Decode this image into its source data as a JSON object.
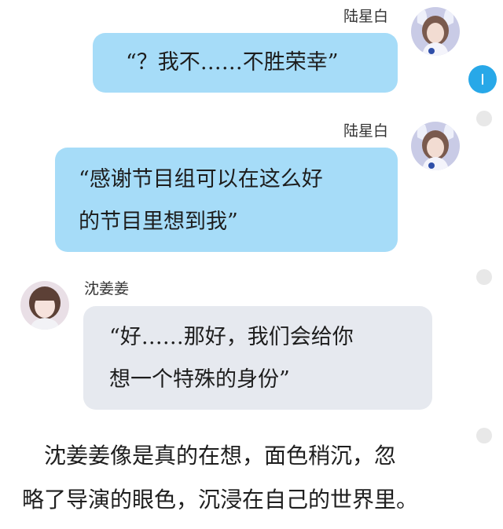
{
  "messages": [
    {
      "sender": "陆星白",
      "lines": [
        "“？我不……不胜荣幸”"
      ]
    },
    {
      "sender": "陆星白",
      "lines": [
        "“感谢节目组可以在这么好",
        "的节目里想到我”"
      ]
    },
    {
      "sender": "沈姜姜",
      "lines": [
        "“好……那好，我们会给你",
        "想一个特殊的身份”"
      ]
    }
  ],
  "narration": [
    "　沈姜姜像是真的在想，面色稍沉，忽",
    "略了导演的眼色，沉浸在自己的世界里。"
  ],
  "colors": {
    "right_bubble": "#a6dcf8",
    "left_bubble": "#e6e9ef",
    "accent": "#28a8e8"
  }
}
